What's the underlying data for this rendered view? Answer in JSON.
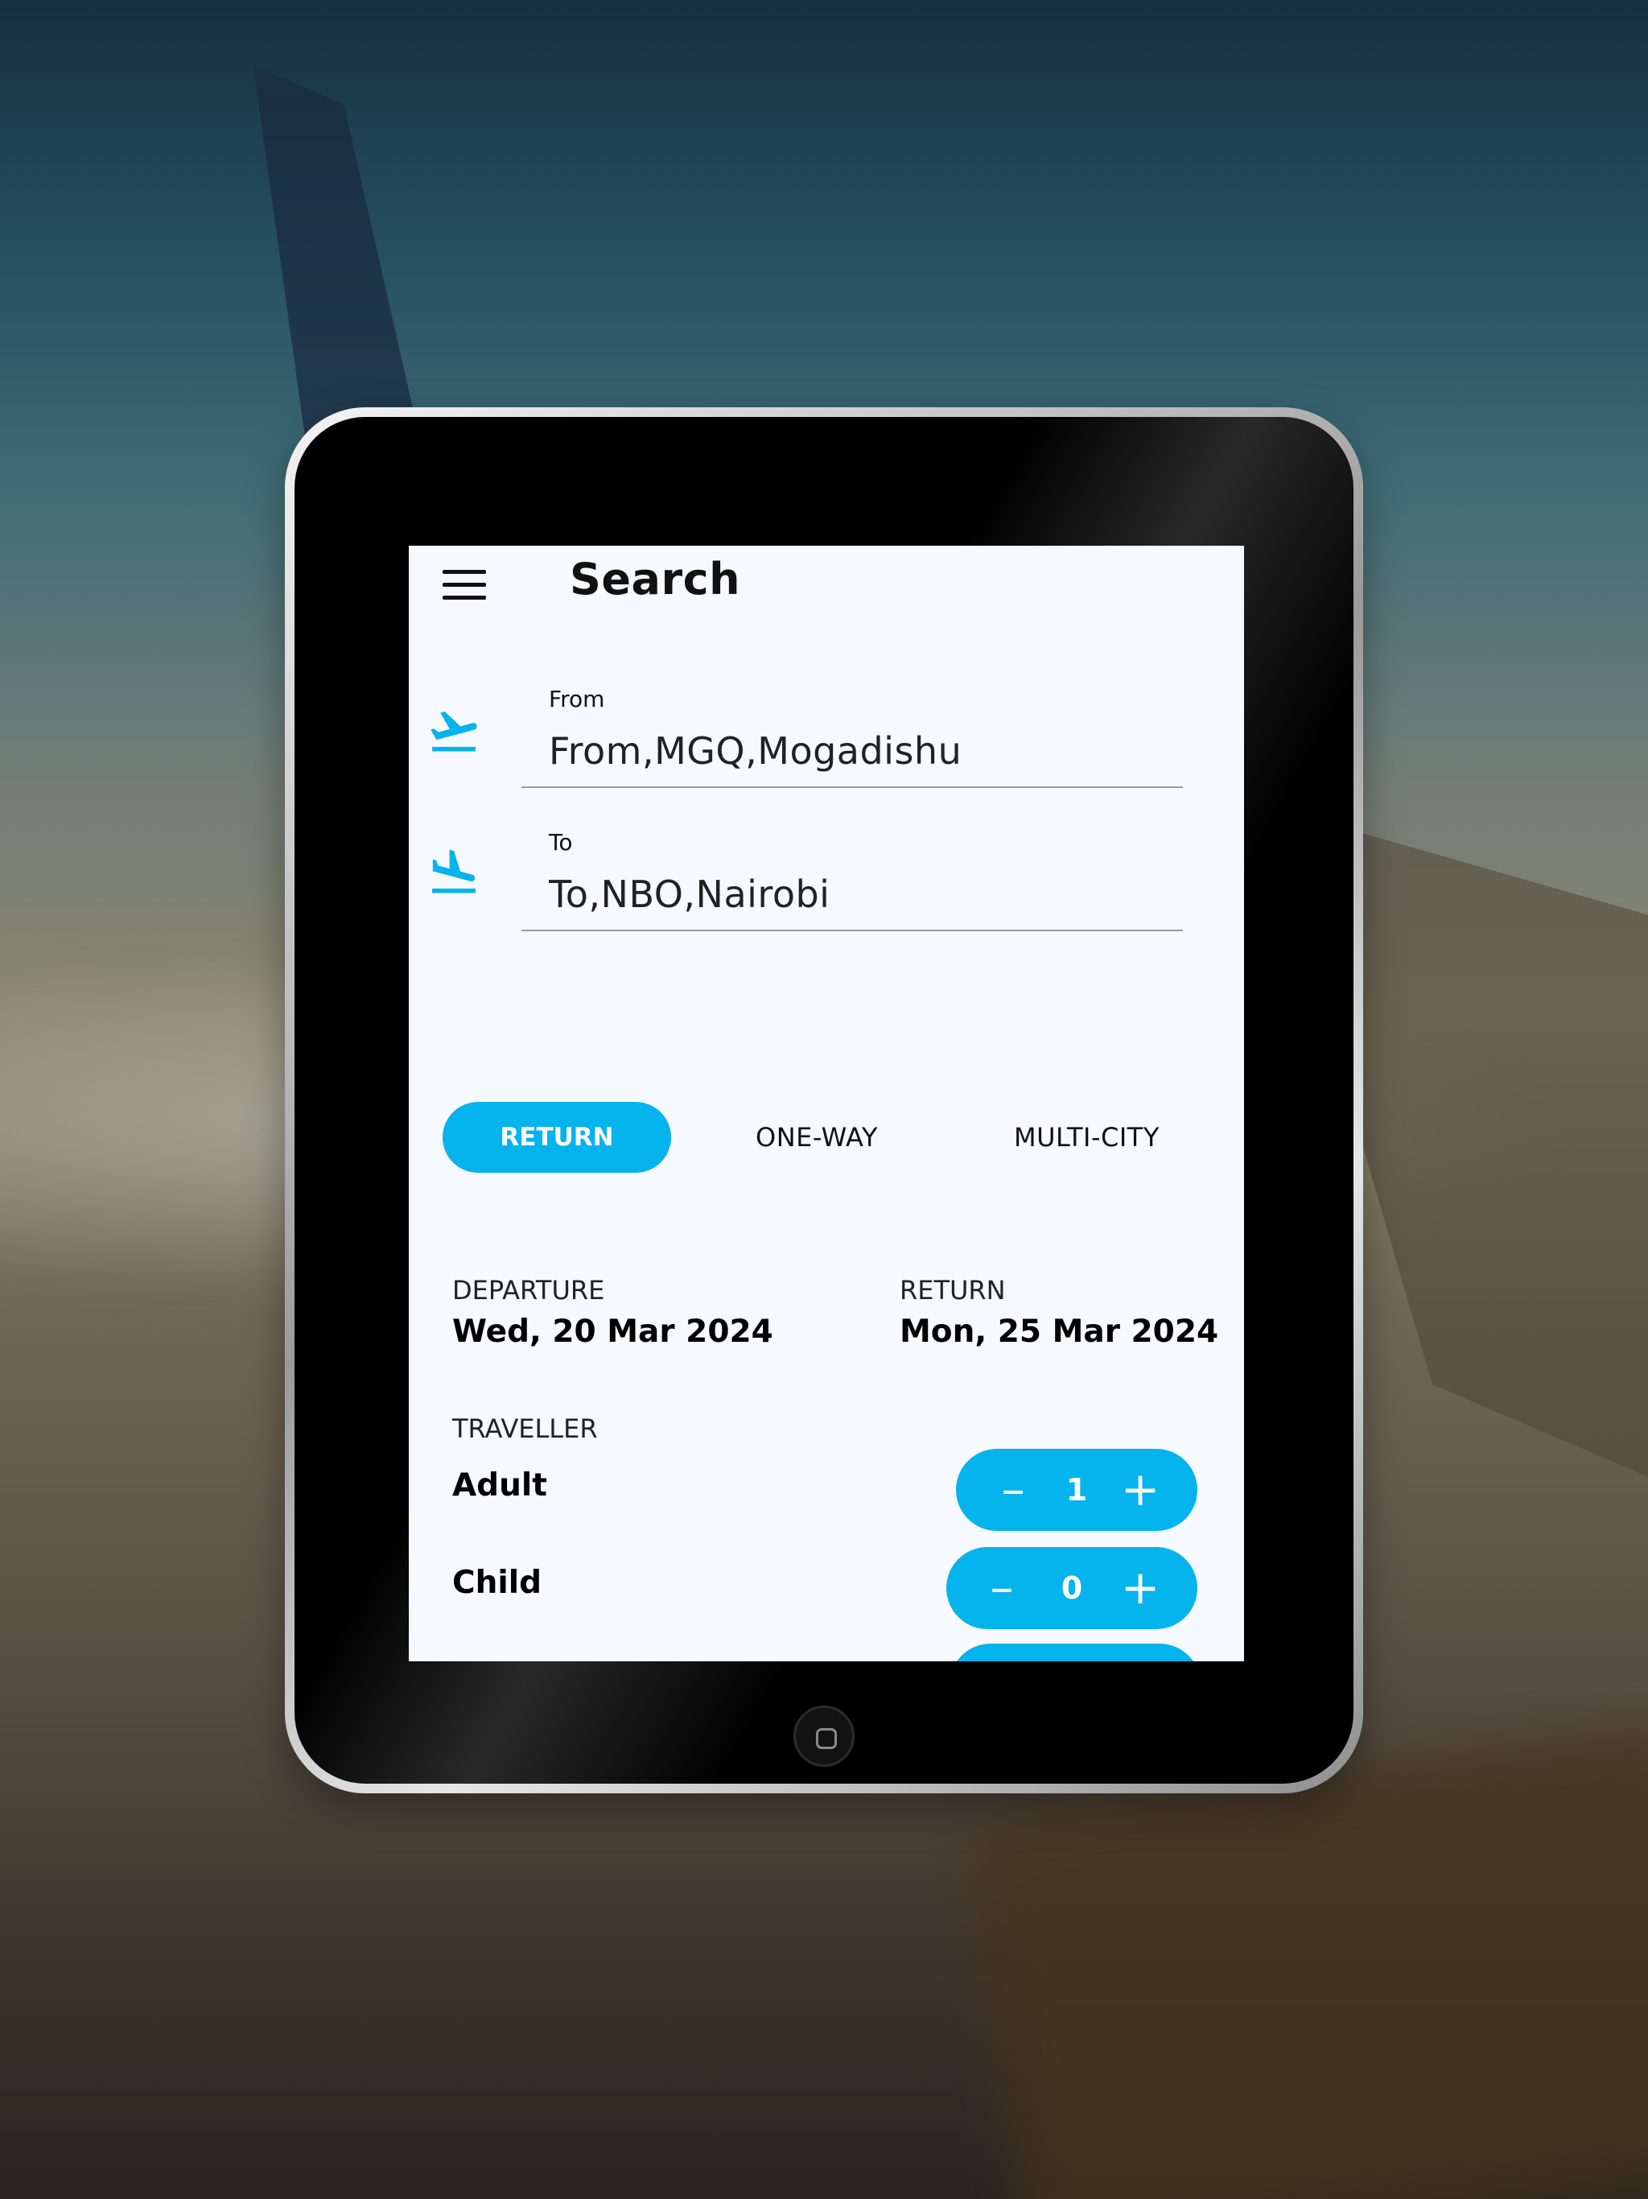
{
  "header": {
    "title": "Search"
  },
  "route": {
    "from": {
      "label": "From",
      "value": "From,MGQ,Mogadishu"
    },
    "to": {
      "label": "To",
      "value": "To,NBO,Nairobi"
    }
  },
  "trip_types": {
    "selected": "RETURN",
    "options": [
      "RETURN",
      "ONE-WAY",
      "MULTI-CITY"
    ]
  },
  "dates": {
    "departure": {
      "label": "DEPARTURE",
      "value": "Wed, 20 Mar 2024"
    },
    "return": {
      "label": "RETURN",
      "value": "Mon, 25 Mar 2024"
    }
  },
  "travellers": {
    "label": "TRAVELLER",
    "adult": {
      "label": "Adult",
      "count": "1"
    },
    "child": {
      "label": "Child",
      "count": "0"
    }
  },
  "icons": {
    "menu": "hamburger-menu-icon",
    "departure": "flight-takeoff-icon",
    "arrival": "flight-land-icon",
    "decrement": "minus-icon",
    "increment": "plus-icon",
    "home_button": "home-button-icon"
  },
  "colors": {
    "accent": "#05b3ed",
    "screen_bg": "#f6fafe",
    "text": "#111111",
    "divider": "#9c9c9c"
  }
}
